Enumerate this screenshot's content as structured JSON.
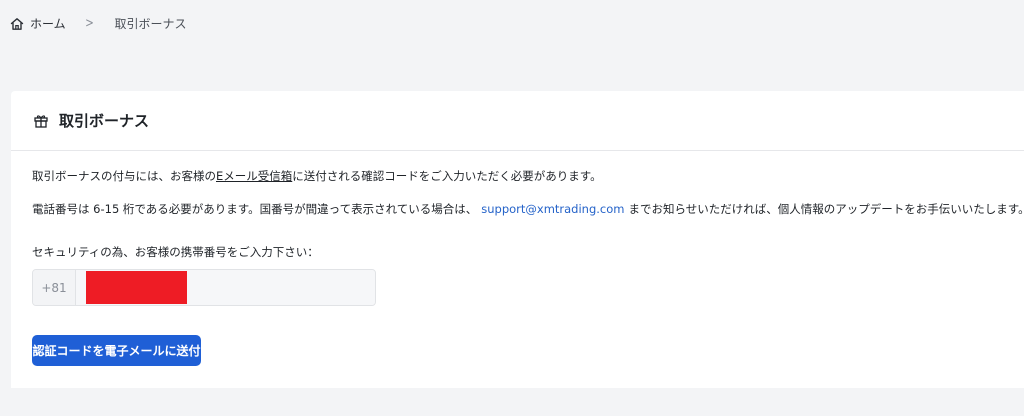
{
  "breadcrumb": {
    "home_icon": "home-icon",
    "home_label": "ホーム",
    "separator": ">",
    "current_label": "取引ボーナス"
  },
  "card": {
    "header_icon": "gift-icon",
    "title": "取引ボーナス",
    "intro_before": "取引ボーナスの付与には、お客様の",
    "intro_link": "Eメール受信箱",
    "intro_after": "に送付される確認コードをご入力いただく必要があります。",
    "phone_note_before": "電話番号は 6-15 桁である必要があります。国番号が間違って表示されている場合は、",
    "support_email": "support@xmtrading.com",
    "phone_note_after": "までお知らせいただければ、個人情報のアップデートをお手伝いいたします。",
    "field_label": "セキュリティの為、お客様の携帯番号をご入力下さい：",
    "country_code": "+81",
    "button_label": "認証コードを電子メールに送付"
  },
  "colors": {
    "page_background": "#f3f4f6",
    "card_background": "#ffffff",
    "link": "#2563c9",
    "button": "#1f5fd6",
    "redaction": "#ee1c25"
  }
}
